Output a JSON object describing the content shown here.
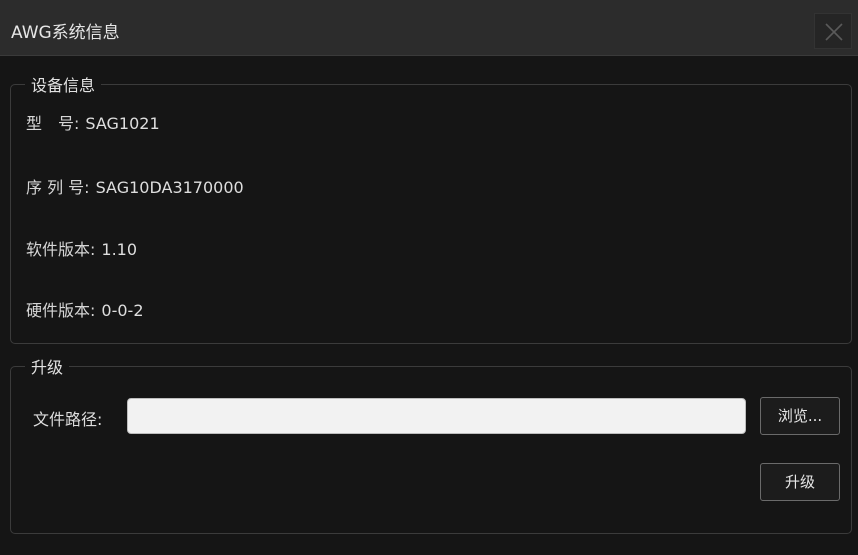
{
  "window": {
    "title": "AWG系统信息",
    "close_icon": "close-icon"
  },
  "device_info": {
    "group_title": "设备信息",
    "rows": [
      {
        "label": "型　号:",
        "value": "SAG1021"
      },
      {
        "label": "序 列 号:",
        "value": "SAG10DA3170000"
      },
      {
        "label": "软件版本:",
        "value": "1.10"
      },
      {
        "label": "硬件版本:",
        "value": "0-0-2"
      }
    ]
  },
  "upgrade": {
    "group_title": "升级",
    "file_path_label": "文件路径:",
    "file_path_value": "",
    "browse_label": "浏览...",
    "upgrade_label": "升级"
  },
  "colors": {
    "background": "#151515",
    "titlebar": "#2c2c2c",
    "text": "#dedede",
    "input_bg": "#f2f2f2"
  }
}
